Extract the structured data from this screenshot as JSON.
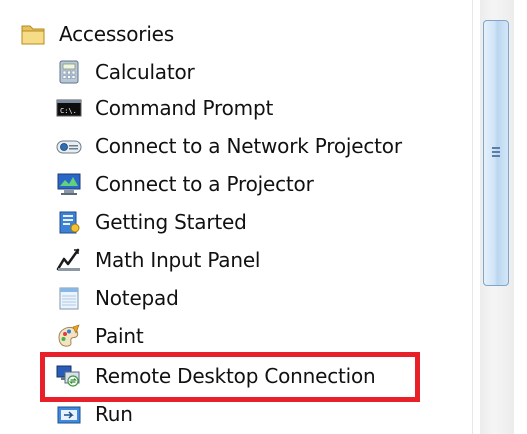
{
  "folder": {
    "label": "Accessories",
    "icon": "folder-icon"
  },
  "items": [
    {
      "label": "Calculator",
      "icon": "calculator-icon"
    },
    {
      "label": "Command Prompt",
      "icon": "command-prompt-icon"
    },
    {
      "label": "Connect to a Network Projector",
      "icon": "network-projector-icon"
    },
    {
      "label": "Connect to a Projector",
      "icon": "projector-icon"
    },
    {
      "label": "Getting Started",
      "icon": "getting-started-icon"
    },
    {
      "label": "Math Input Panel",
      "icon": "math-input-panel-icon"
    },
    {
      "label": "Notepad",
      "icon": "notepad-icon"
    },
    {
      "label": "Paint",
      "icon": "paint-icon"
    },
    {
      "label": "Remote Desktop Connection",
      "icon": "remote-desktop-icon"
    },
    {
      "label": "Run",
      "icon": "run-icon"
    }
  ],
  "command_prompt_icon_text": "C:\\.",
  "colors": {
    "highlight": "#e8202a",
    "scroll_thumb": "#cfe3f7"
  }
}
